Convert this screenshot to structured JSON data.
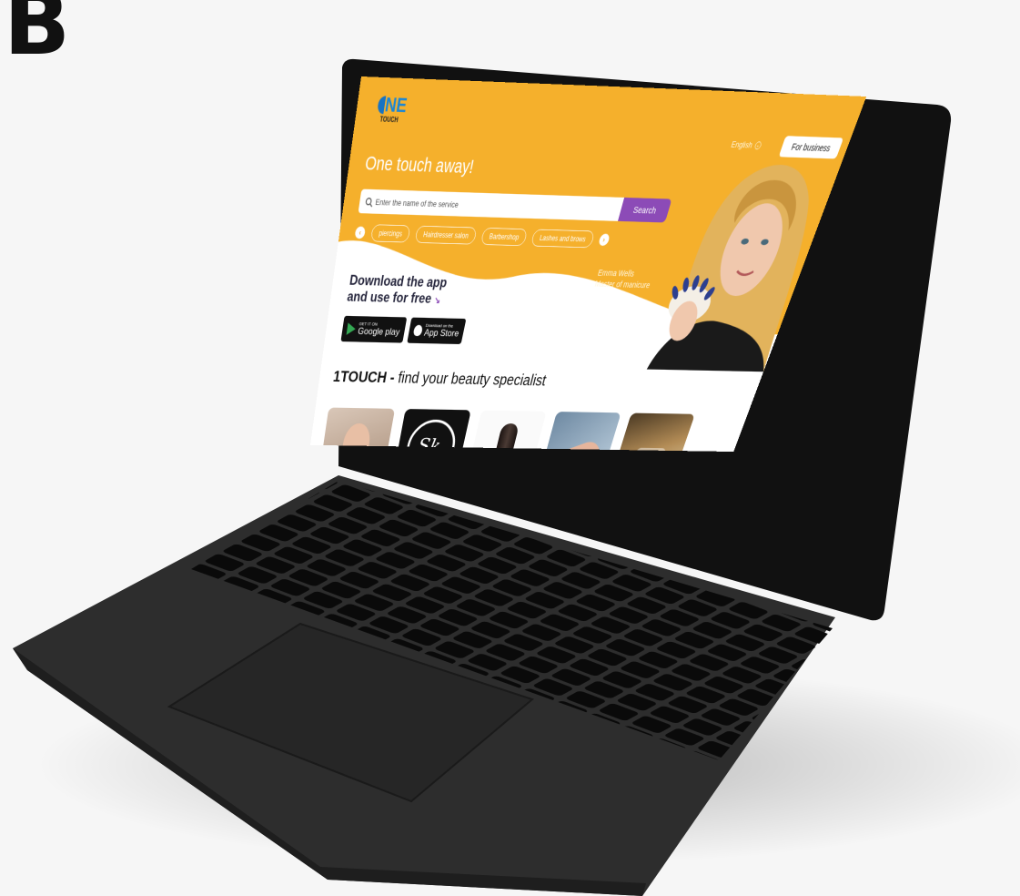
{
  "brand_mark": "B",
  "site": {
    "logo_main": "NE",
    "logo_sub": "TOUCH",
    "language": "English",
    "business_button": "For business",
    "tagline": "One touch away!",
    "search": {
      "placeholder": "Enter the name of the service",
      "button": "Search"
    },
    "categories": [
      "piercings",
      "Hairdresser salon",
      "Barbershop",
      "Lashes and brows"
    ],
    "download_title_line1": "Download the app",
    "download_title_line2": "and use for free",
    "download_arrow": "↘",
    "stores": {
      "google": {
        "top": "GET IT ON",
        "name": "Google play"
      },
      "apple": {
        "top": "Download on the",
        "name": "App Store"
      }
    },
    "featured_person": {
      "name": "Emma Wells",
      "role": "Master of manicure"
    },
    "headline_bold": "1TOUCH -",
    "headline_rest": "find your beauty specialist"
  },
  "colors": {
    "accent": "#f5b02c",
    "purple": "#8c4bb7",
    "logo_blue": "#1a86d6",
    "laptop": "#2d2d2d"
  }
}
